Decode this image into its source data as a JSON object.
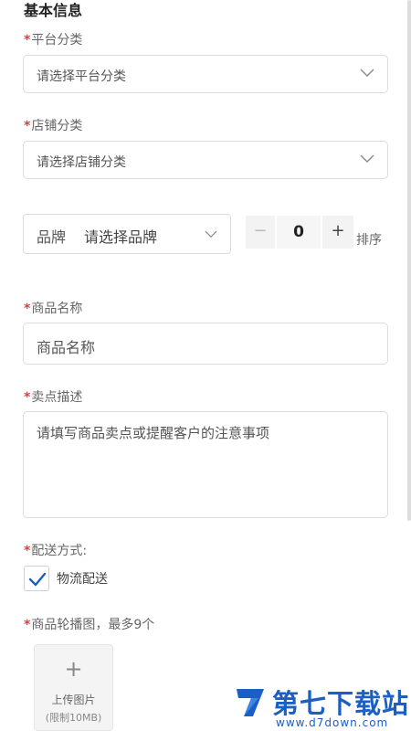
{
  "section_title": "基本信息",
  "required_mark": "*",
  "platform_category": {
    "label": "平台分类",
    "placeholder": "请选择平台分类"
  },
  "store_category": {
    "label": "店铺分类",
    "placeholder": "请选择店铺分类"
  },
  "brand": {
    "label": "品牌",
    "placeholder": "请选择品牌"
  },
  "sort": {
    "minus": "−",
    "value": "0",
    "plus": "+",
    "label": "排序"
  },
  "product_name": {
    "label": "商品名称",
    "placeholder": "商品名称"
  },
  "selling_point": {
    "label": "卖点描述",
    "placeholder": "请填写商品卖点或提醒客户的注意事项"
  },
  "delivery": {
    "label": "配送方式:",
    "option_label": "物流配送",
    "checked": true
  },
  "carousel": {
    "label": "商品轮播图，最多9个",
    "upload_icon": "+",
    "upload_label": "上传图片",
    "upload_hint": "(限制10MB)"
  },
  "watermark": {
    "title": "第七下载站",
    "url": "www.d7down.com"
  },
  "colors": {
    "accent": "#1b5fc4",
    "required": "#e23c3c",
    "border": "#dcdcdc"
  }
}
